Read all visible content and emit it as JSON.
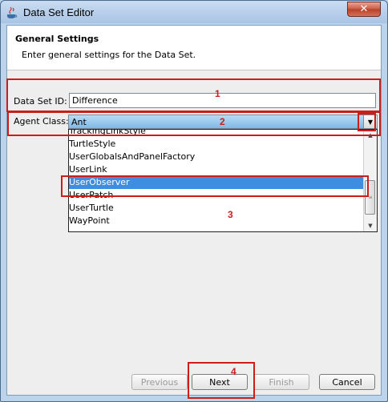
{
  "window": {
    "title": "Data Set Editor",
    "close_label": "✕",
    "icon": "java-cup-icon"
  },
  "header": {
    "title": "General Settings",
    "description": "Enter general settings for the Data Set."
  },
  "form": {
    "dataset_id": {
      "label": "Data Set ID:",
      "value": "Difference"
    },
    "agent_class": {
      "label": "Agent Class:",
      "selected": "Ant"
    }
  },
  "dropdown": {
    "items": [
      "TrackingLinkStyle",
      "TurtleStyle",
      "UserGlobalsAndPanelFactory",
      "UserLink",
      "UserObserver",
      "UserPatch",
      "UserTurtle",
      "WayPoint"
    ],
    "selected": "UserObserver"
  },
  "buttons": {
    "previous": "Previous",
    "next": "Next",
    "finish": "Finish",
    "cancel": "Cancel"
  },
  "annotations": [
    "1",
    "2",
    "3",
    "4"
  ],
  "colors": {
    "annotation": "#cc1d1d",
    "selection": "#3d8ee0"
  }
}
